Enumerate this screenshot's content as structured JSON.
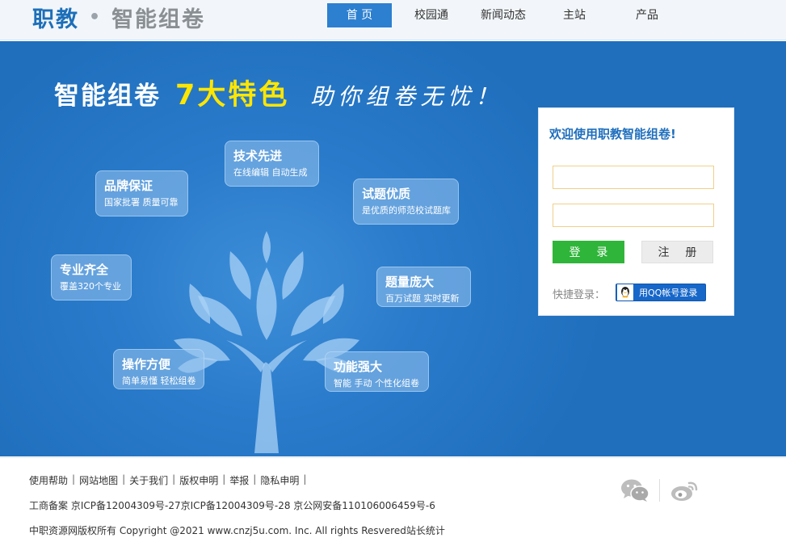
{
  "header": {
    "logo_brand": "职教",
    "logo_dot": "•",
    "logo_sub": "智能组卷",
    "nav": [
      {
        "label": "首 页"
      },
      {
        "label": "校园通"
      },
      {
        "label": "新闻动态"
      },
      {
        "label": "主站"
      },
      {
        "label": "产品"
      }
    ]
  },
  "banner": {
    "headline_1": "智能组卷",
    "headline_2": "7大特色",
    "headline_3": "助你组卷无忧！",
    "features": [
      {
        "title": "技术先进",
        "desc": "在线编辑  自动生成"
      },
      {
        "title": "品牌保证",
        "desc": "国家批署  质量可靠"
      },
      {
        "title": "试题优质",
        "desc": "是优质的师范校试题库"
      },
      {
        "title": "专业齐全",
        "desc": "覆盖320个专业"
      },
      {
        "title": "题量庞大",
        "desc": "百万试题  实时更新"
      },
      {
        "title": "操作方便",
        "desc": "简单易懂  轻松组卷"
      },
      {
        "title": "功能强大",
        "desc": "智能  手动  个性化组卷"
      }
    ]
  },
  "login": {
    "title": "欢迎使用职教智能组卷!",
    "username_value": "",
    "password_value": "",
    "login_label": "登 录",
    "register_label": "注 册",
    "quick_label": "快捷登录：",
    "qq_label": "用QQ帐号登录"
  },
  "footer": {
    "links": [
      "使用帮助",
      "网站地图",
      "关于我们",
      "版权申明",
      "举报",
      "隐私申明"
    ],
    "icp": "工商备案  京ICP备12004309号-27京ICP备12004309号-28  京公网安备110106006459号-6",
    "copyright": "中职资源网版权所有 Copyright @2021 www.cnzj5u.com. Inc. All rights Resvered站长统计"
  },
  "icons": {
    "wechat": "wechat-icon",
    "weibo": "weibo-icon",
    "qq": "qq-penguin-icon",
    "tree": "tree-illustration"
  },
  "colors": {
    "brand_blue": "#1d6fb9",
    "nav_active": "#2d7fd0",
    "banner_blue": "#2a7bcb",
    "headline_yellow": "#ffe600",
    "login_green": "#2fb53a",
    "qq_blue": "#1767c9"
  }
}
